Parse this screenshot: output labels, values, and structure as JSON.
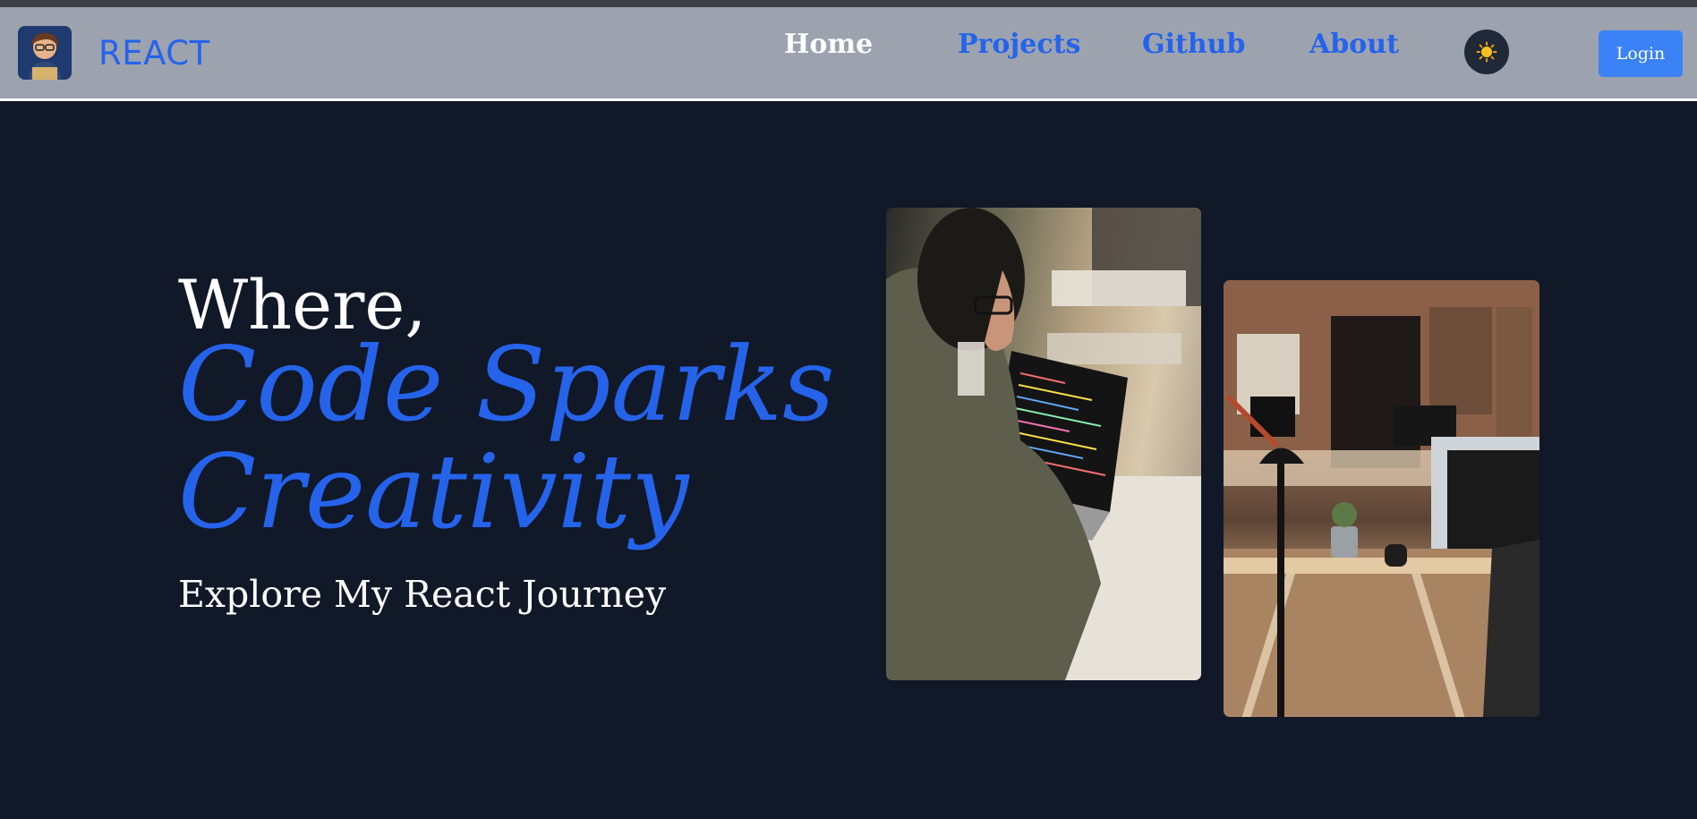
{
  "header": {
    "brand": "REACT",
    "nav": [
      {
        "label": "Home",
        "active": true
      },
      {
        "label": "Projects",
        "active": false
      },
      {
        "label": "Github",
        "active": false
      },
      {
        "label": "About",
        "active": false
      }
    ],
    "theme_toggle_icon": "sun-icon",
    "login_label": "Login"
  },
  "hero": {
    "line1": "Where,",
    "line2": "Code Sparks",
    "line3": "Creativity",
    "subtitle": "Explore My React Journey"
  },
  "colors": {
    "background": "#111827",
    "navbar": "#9ca3af",
    "accent": "#2563eb",
    "button": "#3b82f6"
  }
}
